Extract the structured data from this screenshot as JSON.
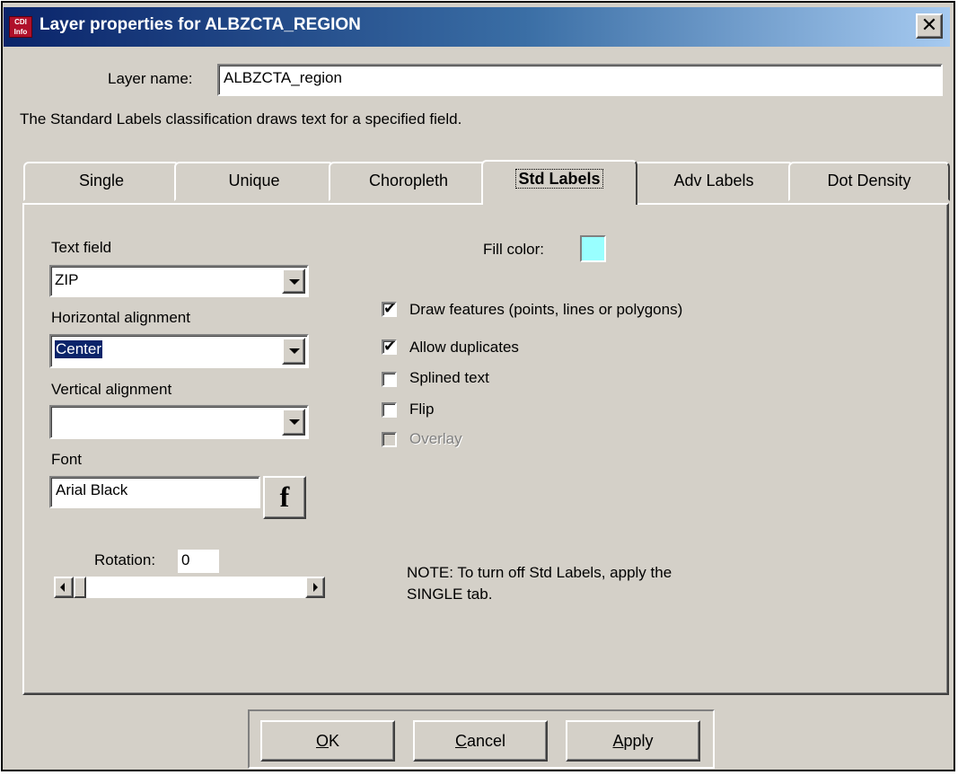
{
  "window": {
    "title": "Layer properties for ALBZCTA_REGION",
    "icon_text": "CDI Info",
    "close_glyph": "✕"
  },
  "layer_name": {
    "label": "Layer name:",
    "value": "ALBZCTA_region"
  },
  "description": "The Standard Labels classification draws text for a specified field.",
  "tabs": [
    {
      "label": "Single",
      "active": false
    },
    {
      "label": "Unique",
      "active": false
    },
    {
      "label": "Choropleth",
      "active": false
    },
    {
      "label": "Std Labels",
      "active": true
    },
    {
      "label": "Adv Labels",
      "active": false
    },
    {
      "label": "Dot Density",
      "active": false
    }
  ],
  "std_labels": {
    "text_field": {
      "label": "Text field",
      "value": "ZIP"
    },
    "horizontal_alignment": {
      "label": "Horizontal alignment",
      "value": "Center"
    },
    "vertical_alignment": {
      "label": "Vertical alignment",
      "value": ""
    },
    "font": {
      "label": "Font",
      "value": "Arial Black",
      "button_glyph": "f"
    },
    "rotation": {
      "label": "Rotation:",
      "value": "0"
    },
    "fill_color": {
      "label": "Fill color:",
      "color": "#99ffff"
    },
    "checkboxes": [
      {
        "label": "Draw features (points, lines or polygons)",
        "checked": true,
        "enabled": true
      },
      {
        "label": "Allow duplicates",
        "checked": true,
        "enabled": true
      },
      {
        "label": "Splined text",
        "checked": false,
        "enabled": true
      },
      {
        "label": "Flip",
        "checked": false,
        "enabled": true
      },
      {
        "label": "Overlay",
        "checked": false,
        "enabled": false
      }
    ],
    "note_line1": "NOTE: To turn off Std Labels, apply the",
    "note_line2": "SINGLE tab."
  },
  "buttons": {
    "ok": {
      "mnemonic": "O",
      "rest": "K"
    },
    "cancel": {
      "mnemonic": "C",
      "rest": "ancel"
    },
    "apply": {
      "mnemonic": "A",
      "rest": "pply"
    }
  },
  "colors": {
    "titlebar_start": "#0a246a",
    "titlebar_end": "#a6caf0",
    "dialog_face": "#d4d0c8",
    "selection": "#0a246a"
  }
}
